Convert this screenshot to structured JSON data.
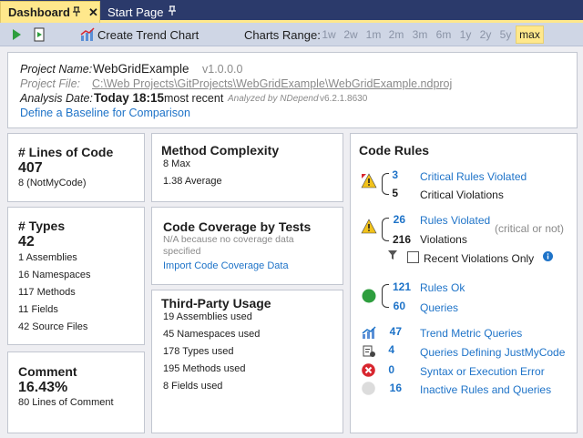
{
  "tabs": [
    {
      "label": "Dashboard",
      "pin": "📌",
      "close": "✕"
    },
    {
      "label": "Start Page",
      "pin": "📌"
    }
  ],
  "toolbar": {
    "create_trend_chart": "Create Trend Chart",
    "charts_range_label": "Charts Range:",
    "ranges": [
      "1w",
      "2w",
      "1m",
      "2m",
      "3m",
      "6m",
      "1y",
      "2y",
      "5y",
      "max"
    ],
    "selected_range": "max"
  },
  "project": {
    "name_label": "Project Name:",
    "name": "WebGridExample",
    "version": "v1.0.0.0",
    "file_label": "Project File:",
    "file": "C:\\Web Projects\\GitProjects\\WebGridExample\\WebGridExample.ndproj",
    "date_label": "Analysis Date:",
    "date": "Today 18:15",
    "most_recent": "most recent",
    "analyzed_by": "Analyzed by NDepend",
    "ndepend_version": "v6.2.1.8630",
    "baseline_link": "Define a Baseline for Comparison"
  },
  "loc": {
    "title": "# Lines of Code",
    "value": "407",
    "notmycode": "8  (NotMyCode)"
  },
  "types": {
    "title": "# Types",
    "value": "42",
    "rows": [
      "1   Assemblies",
      "16   Namespaces",
      "117   Methods",
      "11   Fields",
      "42   Source Files"
    ]
  },
  "comment": {
    "title": "Comment",
    "value": "16.43%",
    "lines": "80   Lines of Comment"
  },
  "complexity": {
    "title": "Method Complexity",
    "max": "8    Max",
    "avg": "1.38    Average"
  },
  "coverage": {
    "title": "Code Coverage by Tests",
    "na_line1": "N/A because no coverage data",
    "na_line2": "specified",
    "import_link": "Import Code Coverage Data"
  },
  "thirdparty": {
    "title": "Third-Party Usage",
    "rows": [
      "19   Assemblies used",
      "45   Namespaces used",
      "178   Types used",
      "195   Methods used",
      "8   Fields used"
    ]
  },
  "rules": {
    "title": "Code Rules",
    "critical_rules_count": "3",
    "critical_rules_label": "Critical Rules Violated",
    "critical_violations_count": "5",
    "critical_violations_label": "Critical Violations",
    "rules_violated_count": "26",
    "rules_violated_label": "Rules Violated",
    "critical_or_not": "(critical or not)",
    "violations_count": "216",
    "violations_label": "Violations",
    "recent_only": "Recent Violations Only",
    "rules_ok_count": "121",
    "rules_ok_label": "Rules Ok",
    "queries_count": "60",
    "queries_label": "Queries",
    "trend_count": "47",
    "trend_label": "Trend Metric Queries",
    "justmycode_count": "4",
    "justmycode_label": "Queries Defining JustMyCode",
    "syntax_count": "0",
    "syntax_label": "Syntax or Execution Error",
    "inactive_count": "16",
    "inactive_label": "Inactive Rules and Queries"
  },
  "colors": {
    "accent_tab": "#ffe88c",
    "header_bg": "#2b3a6b",
    "link": "#1e73c8",
    "ok_green": "#2e9e3e",
    "error_red": "#d8262f",
    "warning_yellow": "#f1c21b"
  }
}
